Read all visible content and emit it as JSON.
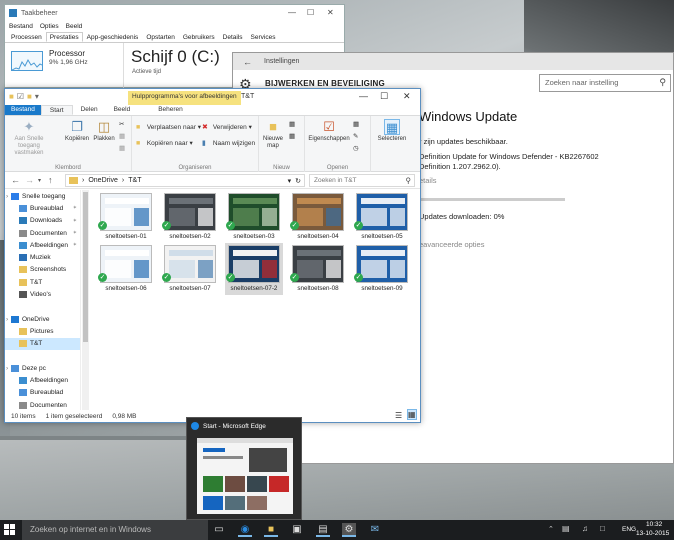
{
  "task_manager": {
    "title": "Taakbeheer",
    "menu": [
      "Bestand",
      "Opties",
      "Beeld"
    ],
    "tabs": [
      "Processen",
      "Prestaties",
      "App-geschiedenis",
      "Opstarten",
      "Gebruikers",
      "Details",
      "Services"
    ],
    "active_tab": "Prestaties",
    "cpu_label": "Processor",
    "cpu_value": "9% 1,96 GHz",
    "disk_title": "Schijf 0 (C:)",
    "disk_sub": "Actieve tijd"
  },
  "settings": {
    "window_title": "Instellingen",
    "section": "BIJWERKEN EN BEVEILIGING",
    "search_placeholder": "Zoeken naar instelling",
    "heading": "Windows Update",
    "line1": "r zijn updates beschikbaar.",
    "line2": "Definition Update for Windows Defender - KB2267602",
    "line3": "Definition 1.207.2962.0).",
    "details_link": "etails",
    "download_text": "Updates downloaden: 0%",
    "download_progress": 0,
    "advanced_link": "eavanceerde opties"
  },
  "explorer": {
    "window_title": "T&T",
    "tools_tab": "Hulpprogramma's voor afbeeldingen",
    "ribbon_tabs": [
      "Bestand",
      "Start",
      "Delen",
      "Beeld",
      "Beheren"
    ],
    "active_ribbon_tab": "Start",
    "ribbon": {
      "pin_label": "Aan Snelle toegang vastmaken",
      "copy_label": "Kopiëren",
      "paste_label": "Plakken",
      "group_clipboard": "Klembord",
      "move_label": "Verplaatsen naar",
      "copyto_label": "Kopiëren naar",
      "delete_label": "Verwijderen",
      "rename_label": "Naam wijzigen",
      "group_organize": "Organiseren",
      "newfolder_label": "Nieuwe map",
      "group_new": "Nieuw",
      "properties_label": "Eigenschappen",
      "group_open": "Openen",
      "select_label": "Selecteren"
    },
    "address": [
      "OneDrive",
      "T&T"
    ],
    "search_placeholder": "Zoeken in T&T",
    "nav_pane": [
      {
        "label": "Snelle toegang",
        "icon": "star-icon",
        "color": "#2b7de9",
        "pinned": false,
        "level": 0
      },
      {
        "label": "Bureaublad",
        "icon": "desktop-icon",
        "color": "#4a90d9",
        "pinned": true,
        "level": 1
      },
      {
        "label": "Downloads",
        "icon": "download-icon",
        "color": "#2a7ab8",
        "pinned": true,
        "level": 1
      },
      {
        "label": "Documenten",
        "icon": "document-icon",
        "color": "#8a8a8a",
        "pinned": true,
        "level": 1
      },
      {
        "label": "Afbeeldingen",
        "icon": "pictures-icon",
        "color": "#3b8ed0",
        "pinned": true,
        "level": 1
      },
      {
        "label": "Muziek",
        "icon": "music-icon",
        "color": "#2a6fb5",
        "pinned": false,
        "level": 1
      },
      {
        "label": "Screenshots",
        "icon": "folder-icon",
        "color": "#e8c25a",
        "pinned": false,
        "level": 1
      },
      {
        "label": "T&T",
        "icon": "folder-icon",
        "color": "#e8c25a",
        "pinned": false,
        "level": 1
      },
      {
        "label": "Video's",
        "icon": "video-icon",
        "color": "#555555",
        "pinned": false,
        "level": 1
      },
      {
        "label": "",
        "icon": "",
        "color": "",
        "pinned": false,
        "level": -1
      },
      {
        "label": "OneDrive",
        "icon": "cloud-icon",
        "color": "#1e78d2",
        "pinned": false,
        "level": 0
      },
      {
        "label": "Pictures",
        "icon": "folder-icon",
        "color": "#e8c25a",
        "pinned": false,
        "level": 1
      },
      {
        "label": "T&T",
        "icon": "folder-icon",
        "color": "#e8c25a",
        "pinned": false,
        "level": 1,
        "selected": true
      },
      {
        "label": "",
        "icon": "",
        "color": "",
        "pinned": false,
        "level": -1
      },
      {
        "label": "Deze pc",
        "icon": "computer-icon",
        "color": "#4a90d9",
        "pinned": false,
        "level": 0
      },
      {
        "label": "Afbeeldingen",
        "icon": "pictures-icon",
        "color": "#3b8ed0",
        "pinned": false,
        "level": 1
      },
      {
        "label": "Bureaublad",
        "icon": "desktop-icon",
        "color": "#4a90d9",
        "pinned": false,
        "level": 1
      },
      {
        "label": "Documenten",
        "icon": "document-icon",
        "color": "#8a8a8a",
        "pinned": false,
        "level": 1
      },
      {
        "label": "Downloads",
        "icon": "download-icon",
        "color": "#2a7ab8",
        "pinned": false,
        "level": 1
      }
    ],
    "files": [
      {
        "name": "sneltoetsen-01",
        "style": "light"
      },
      {
        "name": "sneltoetsen-02",
        "style": "dark"
      },
      {
        "name": "sneltoetsen-03",
        "style": "green"
      },
      {
        "name": "sneltoetsen-04",
        "style": "photo"
      },
      {
        "name": "sneltoetsen-05",
        "style": "blue"
      },
      {
        "name": "sneltoetsen-06",
        "style": "light"
      },
      {
        "name": "sneltoetsen-07",
        "style": "window"
      },
      {
        "name": "sneltoetsen-07-2",
        "style": "edge",
        "selected": true
      },
      {
        "name": "sneltoetsen-08",
        "style": "dark"
      },
      {
        "name": "sneltoetsen-09",
        "style": "blue"
      }
    ],
    "status_count": "10 items",
    "status_selected": "1 item geselecteerd",
    "status_size": "0,98 MB"
  },
  "edge_preview": {
    "title": "Start - Microsoft Edge"
  },
  "taskbar": {
    "search_placeholder": "Zoeken op internet en in Windows",
    "language": "ENG",
    "time": "10:32",
    "date": "13-10-2015"
  }
}
